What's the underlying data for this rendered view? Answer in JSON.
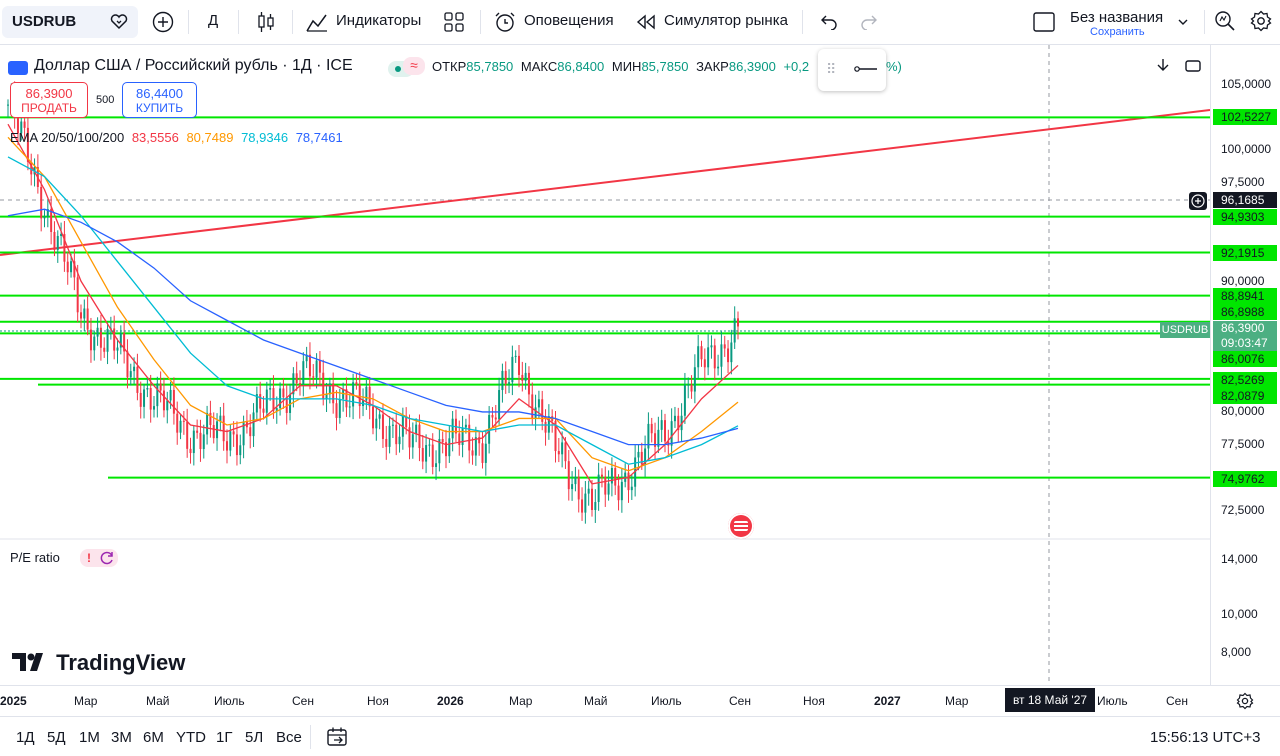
{
  "toolbar": {
    "symbol": "USDRUB",
    "interval": "Д",
    "indicators_label": "Индикаторы",
    "alerts_label": "Оповещения",
    "replay_label": "Симулятор рынка",
    "layout_name": "Без названия",
    "save_label": "Сохранить"
  },
  "legend": {
    "title": "Доллар США / Российский рубль · 1Д · ICE",
    "open_label": "ОТКР",
    "open": "85,7850",
    "high_label": "МАКС",
    "high": "86,8400",
    "low_label": "МИН",
    "low": "85,7850",
    "close_label": "ЗАКР",
    "close": "86,3900",
    "change": "+0,2",
    "change_pct_tail": "%)"
  },
  "trade": {
    "sell_price": "86,3900",
    "sell_label": "ПРОДАТЬ",
    "spread": "500",
    "buy_price": "86,4400",
    "buy_label": "КУПИТЬ"
  },
  "ema": {
    "label": "EMA 20/50/100/200",
    "v20": "83,5556",
    "v50": "80,7489",
    "v100": "78,9346",
    "v200": "78,7461",
    "c20": "#f23645",
    "c50": "#ff9800",
    "c100": "#00bcd4",
    "c200": "#2962ff"
  },
  "price_axis": {
    "ticks": [
      "105,0000",
      "100,0000",
      "97,5000",
      "90,0000",
      "80,0000",
      "77,5000",
      "72,5000"
    ],
    "lower_ticks": [
      "14,000",
      "10,000",
      "8,000"
    ],
    "levels": [
      "102,5227",
      "94,9303",
      "92,1915",
      "88,8941",
      "86,8988",
      "86,0076",
      "82,5269",
      "82,0879",
      "74,9762"
    ],
    "crosshair_price": "96,1685",
    "last_price": "86,3900",
    "countdown": "09:03:47",
    "symbol_tag": "USDRUB"
  },
  "time_axis": {
    "ticks": [
      "2025",
      "Мар",
      "Май",
      "Июль",
      "Сен",
      "Ноя",
      "2026",
      "Мар",
      "Май",
      "Июль",
      "Сен",
      "Ноя",
      "2027",
      "Мар",
      "Июль",
      "Сен"
    ],
    "crosshair_date": "вт 18 Май '27"
  },
  "bottom": {
    "ranges": [
      "1Д",
      "5Д",
      "1М",
      "3М",
      "6М",
      "YTD",
      "1Г",
      "5Л",
      "Все"
    ],
    "clock": "15:56:13 UTC+3"
  },
  "pe_label": "P/E ratio",
  "logo_text": "TradingView",
  "colors": {
    "level_line": "#00e600",
    "trend_line": "#f23645",
    "up": "#089981",
    "down": "#f23645"
  },
  "chart_data": {
    "type": "line",
    "title": "Доллар США / Российский рубль · 1Д · ICE",
    "x": [
      "2025-01",
      "2025-02",
      "2025-03",
      "2025-04",
      "2025-05",
      "2025-06",
      "2025-07",
      "2025-08",
      "2025-09",
      "2025-10",
      "2025-11",
      "2025-12",
      "2026-01",
      "2026-02",
      "2026-03",
      "2026-04",
      "2026-05",
      "2026-06",
      "2026-07",
      "2026-08",
      "2026-09"
    ],
    "series": [
      {
        "name": "USDRUB",
        "values": [
          103.5,
          96.0,
          87.5,
          84.5,
          81.0,
          78.5,
          78.0,
          80.0,
          83.0,
          81.5,
          80.0,
          77.5,
          77.5,
          78.0,
          84.0,
          77.0,
          73.0,
          75.5,
          78.5,
          83.5,
          86.39
        ]
      },
      {
        "name": "EMA 20",
        "values": [
          102.0,
          97.0,
          90.0,
          85.5,
          82.0,
          79.0,
          78.5,
          79.5,
          82.0,
          82.0,
          80.5,
          78.5,
          77.5,
          78.0,
          81.0,
          79.0,
          74.5,
          75.0,
          77.5,
          81.0,
          83.5556
        ]
      },
      {
        "name": "EMA 50",
        "values": [
          101.0,
          98.0,
          93.0,
          88.0,
          84.0,
          80.5,
          79.0,
          79.5,
          81.0,
          81.5,
          81.0,
          79.5,
          78.5,
          78.5,
          79.5,
          79.5,
          76.5,
          75.5,
          76.5,
          78.5,
          80.7489
        ]
      },
      {
        "name": "EMA 100",
        "values": [
          99.5,
          98.0,
          95.0,
          91.5,
          88.0,
          84.5,
          82.0,
          81.0,
          81.0,
          81.0,
          80.5,
          79.5,
          79.0,
          78.5,
          79.0,
          79.0,
          77.5,
          76.0,
          76.5,
          77.5,
          78.9346
        ]
      },
      {
        "name": "EMA 200",
        "values": [
          95.0,
          95.5,
          94.5,
          93.0,
          91.0,
          88.5,
          87.0,
          85.5,
          84.5,
          83.5,
          82.5,
          81.5,
          80.5,
          80.0,
          80.0,
          79.5,
          78.5,
          77.5,
          77.5,
          78.0,
          78.7461
        ]
      }
    ],
    "horizontal_levels": [
      102.5227,
      94.9303,
      92.1915,
      88.8941,
      86.8988,
      86.0076,
      82.5269,
      82.0879,
      74.9762
    ],
    "ylim": [
      70.0,
      107.0
    ]
  }
}
